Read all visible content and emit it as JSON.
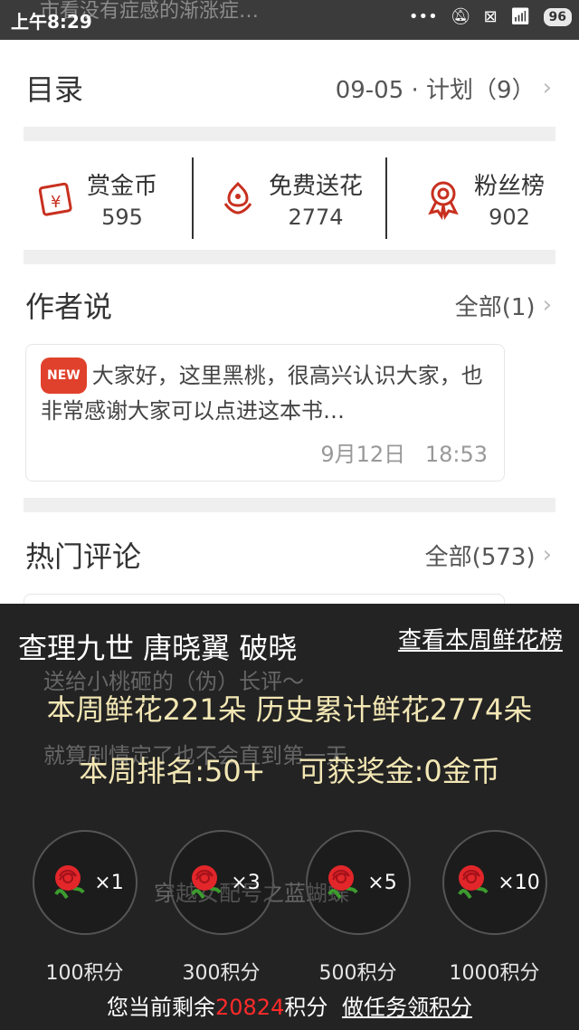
{
  "statusbar": {
    "time": "上午8:29",
    "ghost": "市看没有症感的渐涨症…",
    "battery": "96",
    "icons": [
      "dots-icon",
      "bell-off-icon",
      "sim-x-icon",
      "wifi-icon",
      "battery-icon"
    ]
  },
  "catalog": {
    "title": "目录",
    "right": "09-05 · 计划（9）"
  },
  "stats": [
    {
      "label": "赏金币",
      "value": "595",
      "icon": "reward-coin-icon"
    },
    {
      "label": "免费送花",
      "value": "2774",
      "icon": "flower-icon"
    },
    {
      "label": "粉丝榜",
      "value": "902",
      "icon": "fan-rank-icon"
    }
  ],
  "author_says": {
    "title": "作者说",
    "right": "全部(1)",
    "badge": "NEW",
    "text": "大家好，这里黑桃，很高兴认识大家，也非常感谢大家可以点进这本书…",
    "date": "9月12日",
    "time": "18:53"
  },
  "hot_comments": {
    "title": "热门评论",
    "right": "全部(573)"
  },
  "overlay": {
    "names": "查理九世 唐晓翼 破晓",
    "link": "查看本周鲜花榜",
    "week_line": "本周鲜花221朵 历史累计鲜花2774朵",
    "rank": "本周排名:50+",
    "bonus": "可获奖金:0金币",
    "gifts": [
      {
        "mult": "×1",
        "points": "100积分"
      },
      {
        "mult": "×3",
        "points": "300积分"
      },
      {
        "mult": "×5",
        "points": "500积分"
      },
      {
        "mult": "×10",
        "points": "1000积分"
      }
    ],
    "footer_prefix": "您当前剩余",
    "footer_points": "20824",
    "footer_suffix": "积分",
    "footer_task": "做任务领积分",
    "ghost_lines": [
      "送给小桃砸的（伪）长评～",
      "就算剧情定了也不会直到第一天",
      "穿越女配号之蓝蝴蝶"
    ]
  },
  "colors": {
    "accent": "#c8301f",
    "highlight": "#f3e7b4",
    "points_red": "#ff2a2a"
  }
}
